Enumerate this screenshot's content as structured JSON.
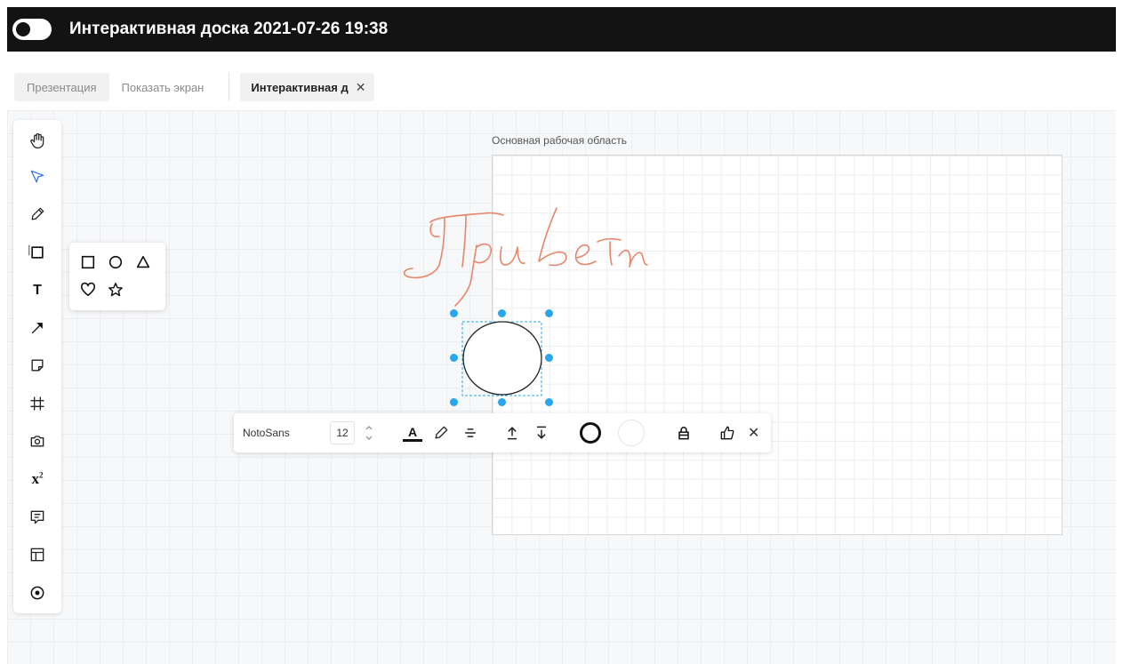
{
  "header": {
    "title": "Интерактивная доска 2021-07-26 19:38",
    "bg_color": "#131313"
  },
  "tabs": {
    "presentation": "Презентация",
    "share_screen": "Показать экран",
    "active": "Интерактивная д",
    "active_close": "✕"
  },
  "canvas": {
    "frame_label": "Основная рабочая область",
    "handwriting_text": "Привет",
    "handwriting_color": "#e8856a"
  },
  "toolbar": {
    "tools": [
      "hand-icon",
      "select-arrow-icon",
      "pencil-icon",
      "shape-square-icon",
      "text-icon",
      "arrow-icon",
      "sticky-note-icon",
      "frame-hash-icon",
      "camera-icon",
      "formula-icon",
      "comment-icon",
      "template-icon",
      "laser-pointer-icon"
    ],
    "active_tool": "select-arrow-icon",
    "active_color": "#2f6fe4",
    "text_tool_glyph": "T",
    "formula_glyph": "x",
    "formula_sup": "2"
  },
  "shapes_popup": {
    "shapes": [
      "square-icon",
      "circle-icon",
      "triangle-icon",
      "heart-icon",
      "star-icon"
    ]
  },
  "properties_bar": {
    "font": "NotoSans",
    "font_size": "12",
    "text_color_glyph": "A",
    "close": "✕",
    "selection_color": "#2aa6ef"
  }
}
